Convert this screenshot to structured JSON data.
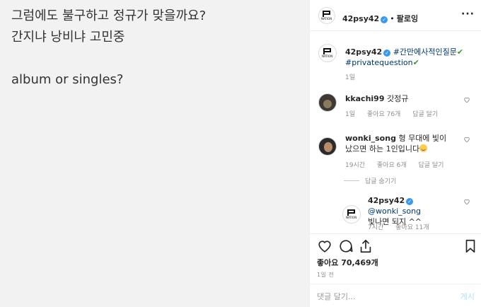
{
  "image": {
    "lines": [
      "그럼에도 불구하고 정규가 맞을까요?",
      "간지냐 낭비냐 고민중",
      "",
      "album or singles?"
    ]
  },
  "header": {
    "username": "42psy42",
    "dot": "•",
    "follow_label": "팔로잉",
    "more_label": "···"
  },
  "caption": {
    "username": "42psy42",
    "hashtag1": "#간만에사적인질문",
    "check1": "✔",
    "hashtag2": "#privatequestion",
    "check2": "✔",
    "time": "1일"
  },
  "comments": [
    {
      "username": "kkachi99",
      "text": "갓정규",
      "time": "1일",
      "likes": "좋아요 76개",
      "reply": "답글 달기"
    },
    {
      "username": "wonki_song",
      "text": "형 무대에 빛이났으면 하는 1인입니다",
      "time": "19시간",
      "likes": "좋아요 6개",
      "reply": "답글 달기"
    }
  ],
  "hide_replies": "답글 숨기기",
  "reply": {
    "username": "42psy42",
    "mention": "@wonki_song",
    "text": "빛나면 되지 ^^",
    "time": "7시간",
    "likes": "좋아요 11개"
  },
  "logo_text": "NATION",
  "actions": {
    "likes_label": "좋아요 70,469개",
    "time_label": "1일 전",
    "comment_placeholder": "댓글 달기...",
    "post_label": "게시"
  },
  "colors": {
    "link": "#003569",
    "verified": "#3897f0",
    "post_disabled": "#b2dffc"
  }
}
